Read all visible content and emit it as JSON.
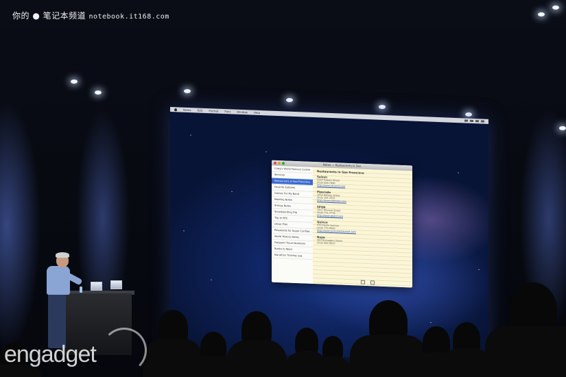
{
  "watermark": {
    "site_text": "你的 ● 笔记本频道",
    "site_url": "notebook.it168.com"
  },
  "logo": {
    "text": "engadget"
  },
  "projected_screen": {
    "menubar": [
      "Notes",
      "Edit",
      "Format",
      "Font",
      "Window",
      "Help"
    ],
    "window_title": "Notes — Restaurants in San",
    "sidebar_items": [
      "Craig's World Famous Cookie",
      "Services",
      "Restaurants in San Francisco",
      "Favorite Eateries",
      "Games For My Band",
      "Meeting Notes",
      "Strings Notes",
      "Snowboarding Trip",
      "Trip to NYC",
      "Oliver Plan",
      "Passwords for Super Confide...",
      "World History Notes",
      "Frequent Travel Numbers",
      "Books to Read",
      "Marathon Training Log"
    ],
    "selected_item_index": 2,
    "note": {
      "title": "Restaurants in San Francisco",
      "blocks": [
        {
          "name": "Saison",
          "address": "2124 Folsom Street",
          "phone": "(415) 828-7990",
          "url": "http://www.saisonsf.com"
        },
        {
          "name": "Piperade",
          "address": "1015 Battery Street",
          "phone": "(415) 391-2555",
          "url": "http://www.piperade.com"
        },
        {
          "name": "SPQR",
          "address": "1911 Fillmore Street",
          "phone": "(415) 771-7779",
          "url": "http://www.spqrsf.com"
        },
        {
          "name": "Quince",
          "address": "470 Pacific Avenue",
          "phone": "(415) 775-8500",
          "url": "http://www.quincerestaurant.com"
        },
        {
          "name": "Nopa",
          "address": "560 Divisadero Street",
          "phone": "(415) 864-8643",
          "url": ""
        }
      ]
    }
  }
}
